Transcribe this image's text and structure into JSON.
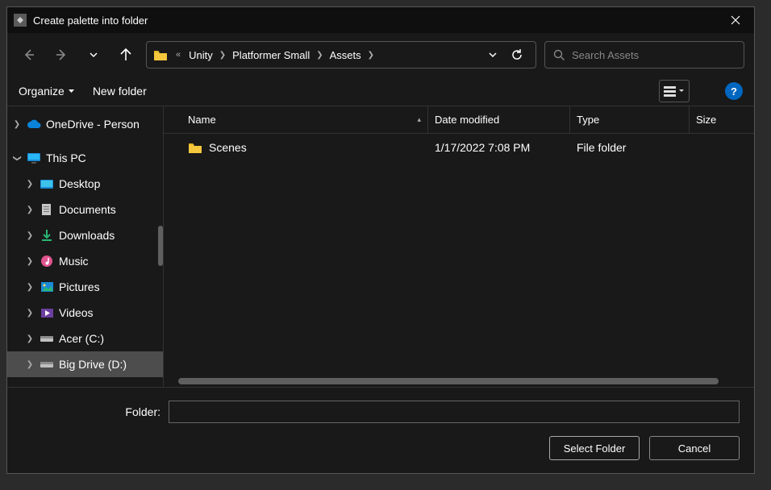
{
  "title": "Create palette into folder",
  "breadcrumb": {
    "segments": [
      {
        "label": "Unity"
      },
      {
        "label": "Platformer Small"
      },
      {
        "label": "Assets"
      }
    ]
  },
  "search": {
    "placeholder": "Search Assets"
  },
  "cmdbar": {
    "organize_label": "Organize",
    "new_folder_label": "New folder"
  },
  "nav_tree": {
    "onedrive": "OneDrive - Person",
    "this_pc": "This PC",
    "desktop": "Desktop",
    "documents": "Documents",
    "downloads": "Downloads",
    "music": "Music",
    "pictures": "Pictures",
    "videos": "Videos",
    "drive_c": "Acer (C:)",
    "drive_d": "Big Drive (D:)"
  },
  "columns": {
    "name": "Name",
    "date": "Date modified",
    "type": "Type",
    "size": "Size"
  },
  "files": [
    {
      "name": "Scenes",
      "date": "1/17/2022 7:08 PM",
      "type": "File folder",
      "size": ""
    }
  ],
  "footer": {
    "folder_label": "Folder:",
    "folder_value": "",
    "select_label": "Select Folder",
    "cancel_label": "Cancel"
  }
}
